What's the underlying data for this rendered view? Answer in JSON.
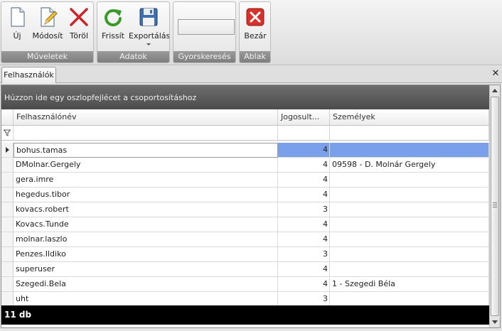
{
  "ribbon": {
    "groups": [
      {
        "label": "Műveletek",
        "buttons": [
          {
            "label": "Új",
            "icon": "new-document-icon"
          },
          {
            "label": "Módosít",
            "icon": "edit-pencil-icon"
          },
          {
            "label": "Töröl",
            "icon": "delete-x-icon"
          }
        ]
      },
      {
        "label": "Adatok",
        "buttons": [
          {
            "label": "Frissít",
            "icon": "refresh-icon"
          },
          {
            "label": "Exportálás",
            "icon": "floppy-disk-icon"
          }
        ]
      },
      {
        "label": "Gyorskeresés"
      },
      {
        "label": "Ablak",
        "buttons": [
          {
            "label": "Bezár",
            "icon": "close-red-icon"
          }
        ]
      }
    ]
  },
  "tabs": [
    {
      "label": "Felhasználók"
    }
  ],
  "grid": {
    "group_hint": "Húzzon ide egy oszlopfejlécet a csoportosításhoz",
    "columns": [
      "Felhasználónév",
      "Jogosult...",
      "Személyek"
    ],
    "rows": [
      {
        "username": "bohus.tamas",
        "jog": "4",
        "szemely": ""
      },
      {
        "username": "DMolnar.Gergely",
        "jog": "4",
        "szemely": "09598 - D. Molnár Gergely"
      },
      {
        "username": "gera.imre",
        "jog": "4",
        "szemely": ""
      },
      {
        "username": "hegedus.tibor",
        "jog": "4",
        "szemely": ""
      },
      {
        "username": "kovacs.robert",
        "jog": "3",
        "szemely": ""
      },
      {
        "username": "Kovacs.Tunde",
        "jog": "4",
        "szemely": ""
      },
      {
        "username": "molnar.laszlo",
        "jog": "4",
        "szemely": ""
      },
      {
        "username": "Penzes.Ildiko",
        "jog": "3",
        "szemely": ""
      },
      {
        "username": "superuser",
        "jog": "4",
        "szemely": ""
      },
      {
        "username": "Szegedi.Bela",
        "jog": "4",
        "szemely": "1 - Szegedi Béla"
      },
      {
        "username": "uht",
        "jog": "3",
        "szemely": ""
      }
    ],
    "footer": "11 db"
  },
  "colors": {
    "accent": "#7aa0ec",
    "ribbon_label": "#8a8a8a",
    "footer_bg": "#000000"
  }
}
